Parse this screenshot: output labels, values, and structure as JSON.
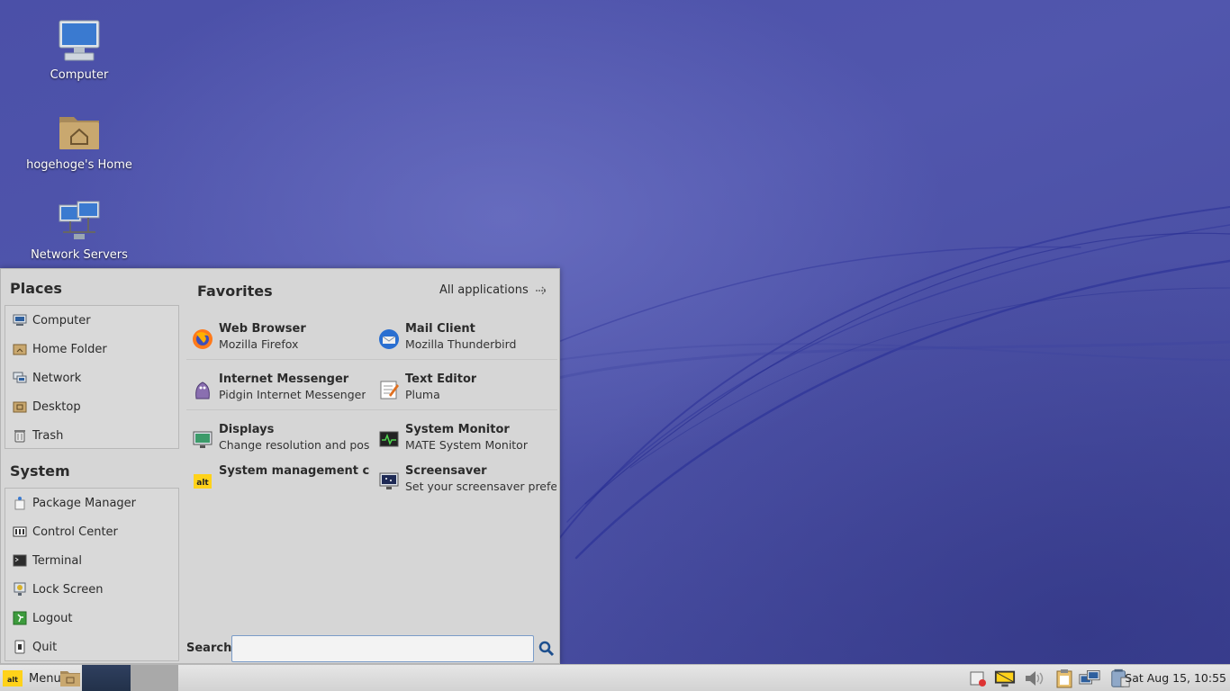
{
  "desktop": {
    "icons": [
      {
        "label": "Computer"
      },
      {
        "label": "hogehoge's Home"
      },
      {
        "label": "Network Servers"
      }
    ]
  },
  "menu": {
    "places_title": "Places",
    "places": [
      {
        "label": "Computer",
        "icon": "computer-icon"
      },
      {
        "label": "Home Folder",
        "icon": "home-folder-icon"
      },
      {
        "label": "Network",
        "icon": "network-icon"
      },
      {
        "label": "Desktop",
        "icon": "desktop-folder-icon"
      },
      {
        "label": "Trash",
        "icon": "trash-icon"
      }
    ],
    "system_title": "System",
    "system": [
      {
        "label": "Package Manager",
        "icon": "package-icon"
      },
      {
        "label": "Control Center",
        "icon": "control-center-icon"
      },
      {
        "label": "Terminal",
        "icon": "terminal-icon"
      },
      {
        "label": "Lock Screen",
        "icon": "lock-icon"
      },
      {
        "label": "Logout",
        "icon": "logout-icon"
      },
      {
        "label": "Quit",
        "icon": "quit-icon"
      }
    ],
    "favorites_title": "Favorites",
    "all_apps_label": "All applications",
    "favorites": [
      {
        "title": "Web Browser",
        "subtitle": "Mozilla Firefox",
        "icon": "firefox-icon"
      },
      {
        "title": "Mail Client",
        "subtitle": "Mozilla Thunderbird",
        "icon": "thunderbird-icon"
      },
      {
        "title": "Internet Messenger",
        "subtitle": "Pidgin Internet Messenger",
        "icon": "pidgin-icon"
      },
      {
        "title": "Text Editor",
        "subtitle": "Pluma",
        "icon": "text-editor-icon"
      },
      {
        "title": "Displays",
        "subtitle": "Change resolution and posit...",
        "icon": "displays-icon"
      },
      {
        "title": "System Monitor",
        "subtitle": "MATE System Monitor",
        "icon": "system-monitor-icon"
      },
      {
        "title": "System management cen...",
        "subtitle": "",
        "icon": "altx-icon"
      },
      {
        "title": "Screensaver",
        "subtitle": "Set your screensaver prefer...",
        "icon": "screensaver-icon"
      }
    ],
    "search_label": "Search:",
    "search_value": ""
  },
  "taskbar": {
    "menu_label": "Menu",
    "clock": "Sat Aug 15, 10:55"
  }
}
